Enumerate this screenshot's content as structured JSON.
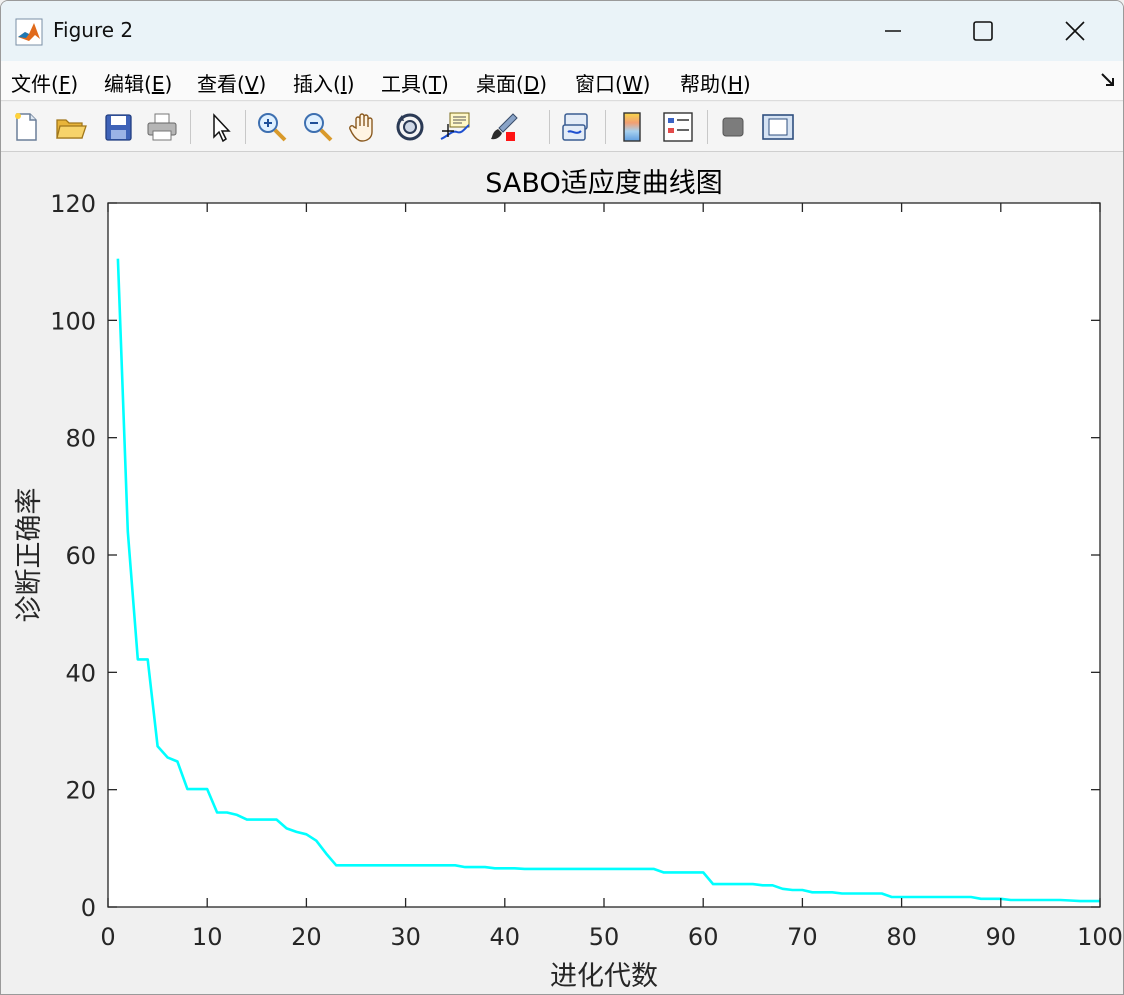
{
  "window": {
    "title": "Figure 2",
    "icon": "matlab-icon",
    "controls": [
      "minimize-icon",
      "maximize-icon",
      "close-icon"
    ]
  },
  "menu": {
    "items": [
      {
        "label": "文件(",
        "key": "F",
        "end": ")"
      },
      {
        "label": "编辑(",
        "key": "E",
        "end": ")"
      },
      {
        "label": "查看(",
        "key": "V",
        "end": ")"
      },
      {
        "label": "插入(",
        "key": "I",
        "end": ")"
      },
      {
        "label": "工具(",
        "key": "T",
        "end": ")"
      },
      {
        "label": "桌面(",
        "key": "D",
        "end": ")"
      },
      {
        "label": "窗口(",
        "key": "W",
        "end": ")"
      },
      {
        "label": "帮助(",
        "key": "H",
        "end": ")"
      }
    ]
  },
  "toolbar": {
    "buttons": [
      "new-figure-icon",
      "open-file-icon",
      "save-icon",
      "print-icon",
      "edit-plot-pointer-icon",
      "zoom-in-icon",
      "zoom-out-icon",
      "pan-hand-icon",
      "rotate-3d-icon",
      "data-cursor-icon",
      "brush-icon",
      "link-plot-icon",
      "colorbar-icon",
      "legend-icon",
      "hide-plot-tools-icon",
      "show-plot-tools-icon"
    ]
  },
  "colors": {
    "line": "#00ffff",
    "axes_bg": "#ffffff",
    "figure_bg": "#f0f0f0"
  },
  "chart_data": {
    "type": "line",
    "title": "SABO适应度曲线图",
    "xlabel": "进化代数",
    "ylabel": "诊断正确率",
    "xlim": [
      0,
      100
    ],
    "ylim": [
      0,
      120
    ],
    "xticks": [
      0,
      10,
      20,
      30,
      40,
      50,
      60,
      70,
      80,
      90,
      100
    ],
    "yticks": [
      0,
      20,
      40,
      60,
      80,
      100,
      120
    ],
    "grid": false,
    "series": [
      {
        "x": [
          1,
          2,
          3,
          4,
          5,
          6,
          7,
          8,
          9,
          10,
          11,
          12,
          13,
          14,
          15,
          16,
          17,
          18,
          19,
          20,
          21,
          22,
          23,
          24,
          25,
          26,
          27,
          28,
          29,
          30,
          31,
          32,
          33,
          34,
          35,
          36,
          37,
          38,
          39,
          40,
          41,
          42,
          43,
          44,
          45,
          46,
          47,
          48,
          49,
          50,
          51,
          52,
          53,
          54,
          55,
          56,
          57,
          58,
          59,
          60,
          61,
          62,
          63,
          64,
          65,
          66,
          67,
          68,
          69,
          70,
          71,
          72,
          73,
          74,
          75,
          76,
          77,
          78,
          79,
          80,
          81,
          82,
          83,
          84,
          85,
          86,
          87,
          88,
          89,
          90,
          91,
          92,
          93,
          94,
          95,
          96,
          97,
          98,
          99,
          100
        ],
        "y": [
          110.5,
          64,
          42.2,
          42.2,
          27.4,
          25.5,
          24.8,
          20.1,
          20.1,
          20.1,
          16.1,
          16.1,
          15.7,
          14.9,
          14.9,
          14.9,
          14.9,
          13.4,
          12.8,
          12.4,
          11.3,
          9.1,
          7.1,
          7.1,
          7.1,
          7.1,
          7.1,
          7.1,
          7.1,
          7.1,
          7.1,
          7.1,
          7.1,
          7.1,
          7.1,
          6.8,
          6.8,
          6.8,
          6.6,
          6.6,
          6.6,
          6.5,
          6.5,
          6.5,
          6.5,
          6.5,
          6.5,
          6.5,
          6.5,
          6.5,
          6.5,
          6.5,
          6.5,
          6.5,
          6.5,
          5.9,
          5.9,
          5.9,
          5.9,
          5.9,
          3.9,
          3.9,
          3.9,
          3.9,
          3.9,
          3.7,
          3.7,
          3.1,
          2.9,
          2.9,
          2.5,
          2.5,
          2.5,
          2.3,
          2.3,
          2.3,
          2.3,
          2.3,
          1.7,
          1.7,
          1.7,
          1.7,
          1.7,
          1.7,
          1.7,
          1.7,
          1.7,
          1.4,
          1.4,
          1.4,
          1.2,
          1.2,
          1.2,
          1.2,
          1.2,
          1.2,
          1.1,
          1.0,
          1.0,
          1.0
        ]
      }
    ]
  }
}
